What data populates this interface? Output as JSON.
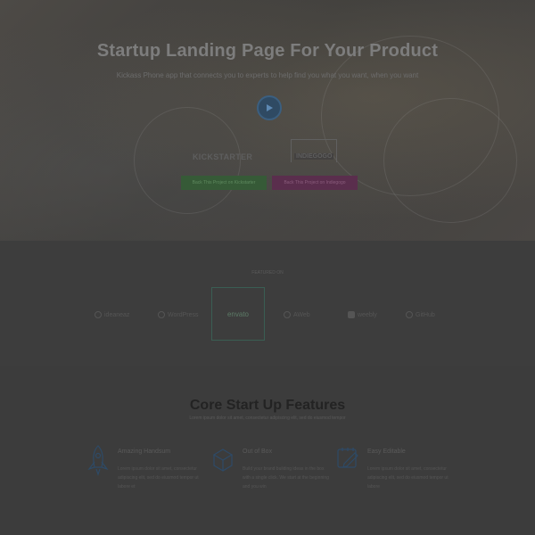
{
  "hero": {
    "title": "Startup Landing Page For Your Product",
    "subtitle": "Kickass Phone app that connects you to experts to help find you what you want, when you want",
    "play_icon": "play-icon",
    "logos": {
      "kickstarter": "KICKSTARTER",
      "indiegogo": "INDIEGOGO"
    },
    "buttons": {
      "back_kickstarter": "Back This Project on Kickstarter",
      "back_indiegogo": "Back This Project on Indiegogo"
    },
    "colors": {
      "play": "#2f4a63",
      "green_button": "#365a37",
      "pink_button": "#5a2e4d"
    }
  },
  "featured": {
    "label": "FEATURED ON",
    "brands": [
      {
        "name": "ideaneaz",
        "icon": "brand-circle-icon"
      },
      {
        "name": "WordPress",
        "icon": "wordpress-icon"
      },
      {
        "name": "envato",
        "icon": "envato-icon"
      },
      {
        "name": "AWeb",
        "icon": "aweb-icon"
      },
      {
        "name": "weebly",
        "icon": "weebly-icon"
      },
      {
        "name": "GitHub",
        "icon": "github-icon"
      }
    ],
    "highlight_color": "#3a5e53"
  },
  "features": {
    "title": "Core Start Up Features",
    "subtitle": "Lorem ipsum dolor sit amet, consectetur adipiscing elit, sed do eiusmod tempor",
    "items": [
      {
        "icon": "rocket-icon",
        "title": "Amazing Handsum",
        "desc": "Lorem ipsum dolor sit amet, consectetur adipiscing elit, sed do eiusmod tempor ut labore et"
      },
      {
        "icon": "box-icon",
        "title": "Out of Box",
        "desc": "Build your brand building ideas in the box with a single click. We start at the beginning and you win"
      },
      {
        "icon": "edit-icon",
        "title": "Easy Editable",
        "desc": "Lorem ipsum dolor sit amet, consectetur adipiscing elit, sed do eiusmod tempor ut labore"
      }
    ]
  }
}
